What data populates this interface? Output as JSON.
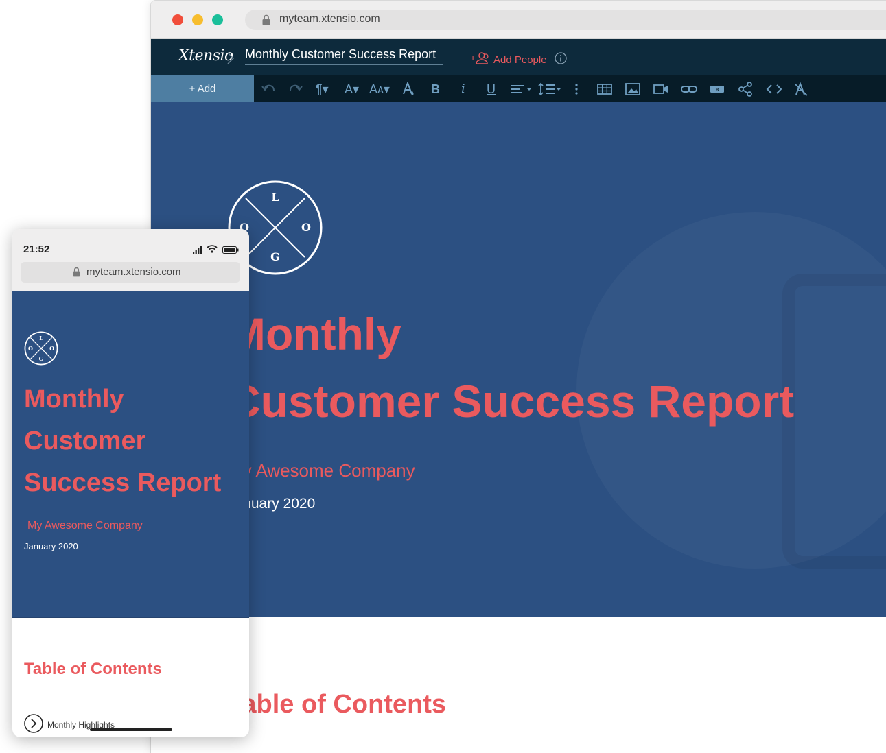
{
  "desktop": {
    "url": "myteam.xtensio.com",
    "brand": "Xtensio",
    "doc_title": "Monthly Customer Success Report",
    "add_people_label": "Add People",
    "toolbar": {
      "add_label": "+ Add",
      "icons": [
        "undo-icon",
        "redo-icon",
        "paragraph-icon",
        "font-icon",
        "font-size-icon",
        "text-color-icon",
        "bold-icon",
        "italic-icon",
        "underline-icon",
        "align-icon",
        "line-spacing-icon",
        "more-vertical-icon",
        "table-icon",
        "image-icon",
        "video-icon",
        "link-icon",
        "button-icon",
        "share-icon",
        "code-icon",
        "clear-format-icon"
      ]
    },
    "hero": {
      "logo_letters": {
        "top": "L",
        "left": "O",
        "right": "O",
        "bottom": "G"
      },
      "title_line1": "Monthly",
      "title_line2": "Customer Success Report",
      "company": "My Awesome Company",
      "date": "January 2020"
    },
    "toc_heading": "Table of Contents"
  },
  "mobile": {
    "time": "21:52",
    "url": "myteam.xtensio.com",
    "hero": {
      "logo_letters": {
        "top": "L",
        "left": "O",
        "right": "O",
        "bottom": "G"
      },
      "title_line1": "Monthly",
      "title_line2": "Customer",
      "title_line3": "Success Report",
      "company": "My Awesome Company",
      "date": "January 2020"
    },
    "toc_heading": "Table of Contents",
    "toc_items": [
      "Monthly Highlights"
    ]
  },
  "colors": {
    "hero_bg": "#2c5082",
    "accent": "#ea5a5e",
    "appbar_bg": "#0d2a3c",
    "toolbar_bg": "#071c28",
    "add_button_bg": "#4e7ea2",
    "toolbar_icon": "#6f9ec0"
  }
}
